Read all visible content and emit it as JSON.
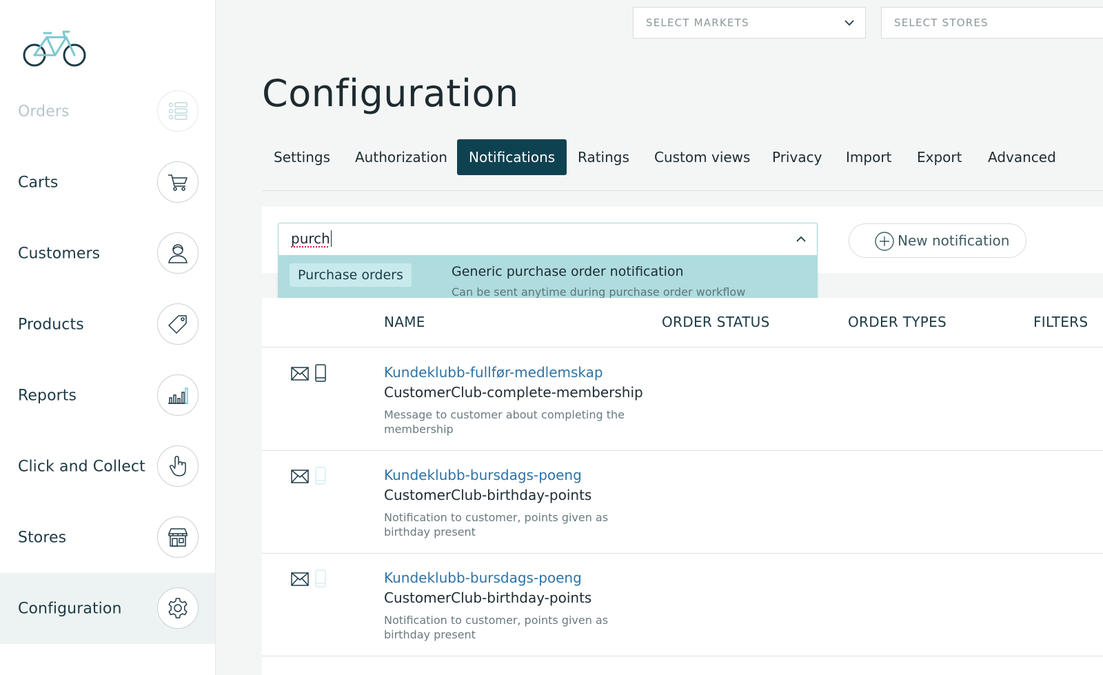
{
  "sidebar": {
    "items": [
      {
        "label": "Orders",
        "icon": "list-icon"
      },
      {
        "label": "Carts",
        "icon": "cart-icon"
      },
      {
        "label": "Customers",
        "icon": "person-icon"
      },
      {
        "label": "Products",
        "icon": "tag-icon"
      },
      {
        "label": "Reports",
        "icon": "bar-chart-icon"
      },
      {
        "label": "Click and Collect",
        "icon": "hand-pointer-icon"
      },
      {
        "label": "Stores",
        "icon": "storefront-icon"
      },
      {
        "label": "Configuration",
        "icon": "gear-icon"
      }
    ],
    "active": "Configuration"
  },
  "header": {
    "markets_placeholder": "SELECT MARKETS",
    "stores_placeholder": "SELECT STORES"
  },
  "page": {
    "title": "Configuration"
  },
  "tabs": [
    {
      "label": "Settings"
    },
    {
      "label": "Authorization"
    },
    {
      "label": "Notifications"
    },
    {
      "label": "Ratings"
    },
    {
      "label": "Custom views"
    },
    {
      "label": "Privacy"
    },
    {
      "label": "Import"
    },
    {
      "label": "Export"
    },
    {
      "label": "Advanced"
    }
  ],
  "active_tab": "Notifications",
  "search": {
    "value": "purch",
    "suggestion": {
      "category": "Purchase orders",
      "title": "Generic purchase order notification",
      "subtitle": "Can be sent anytime during purchase order workflow"
    }
  },
  "toolbar": {
    "new_label": "New notification"
  },
  "table": {
    "columns": [
      "NAME",
      "ORDER STATUS",
      "ORDER TYPES",
      "FILTERS"
    ],
    "rows": [
      {
        "link": "Kundeklubb-fullfør-medlemskap",
        "name": "CustomerClub-complete-membership",
        "description": "Message to customer about completing the membership",
        "email": true,
        "sms": true
      },
      {
        "link": "Kundeklubb-bursdags-poeng",
        "name": "CustomerClub-birthday-points",
        "description": "Notification to customer, points given as birthday present",
        "email": true,
        "sms": false
      },
      {
        "link": "Kundeklubb-bursdags-poeng",
        "name": "CustomerClub-birthday-points",
        "description": "Notification to customer, points given as birthday present",
        "email": true,
        "sms": false
      }
    ]
  },
  "colors": {
    "accent": "#0f4251",
    "link": "#2e73a5",
    "dropdown_bg": "#aedcdf",
    "logo": "#7cc7cf"
  }
}
